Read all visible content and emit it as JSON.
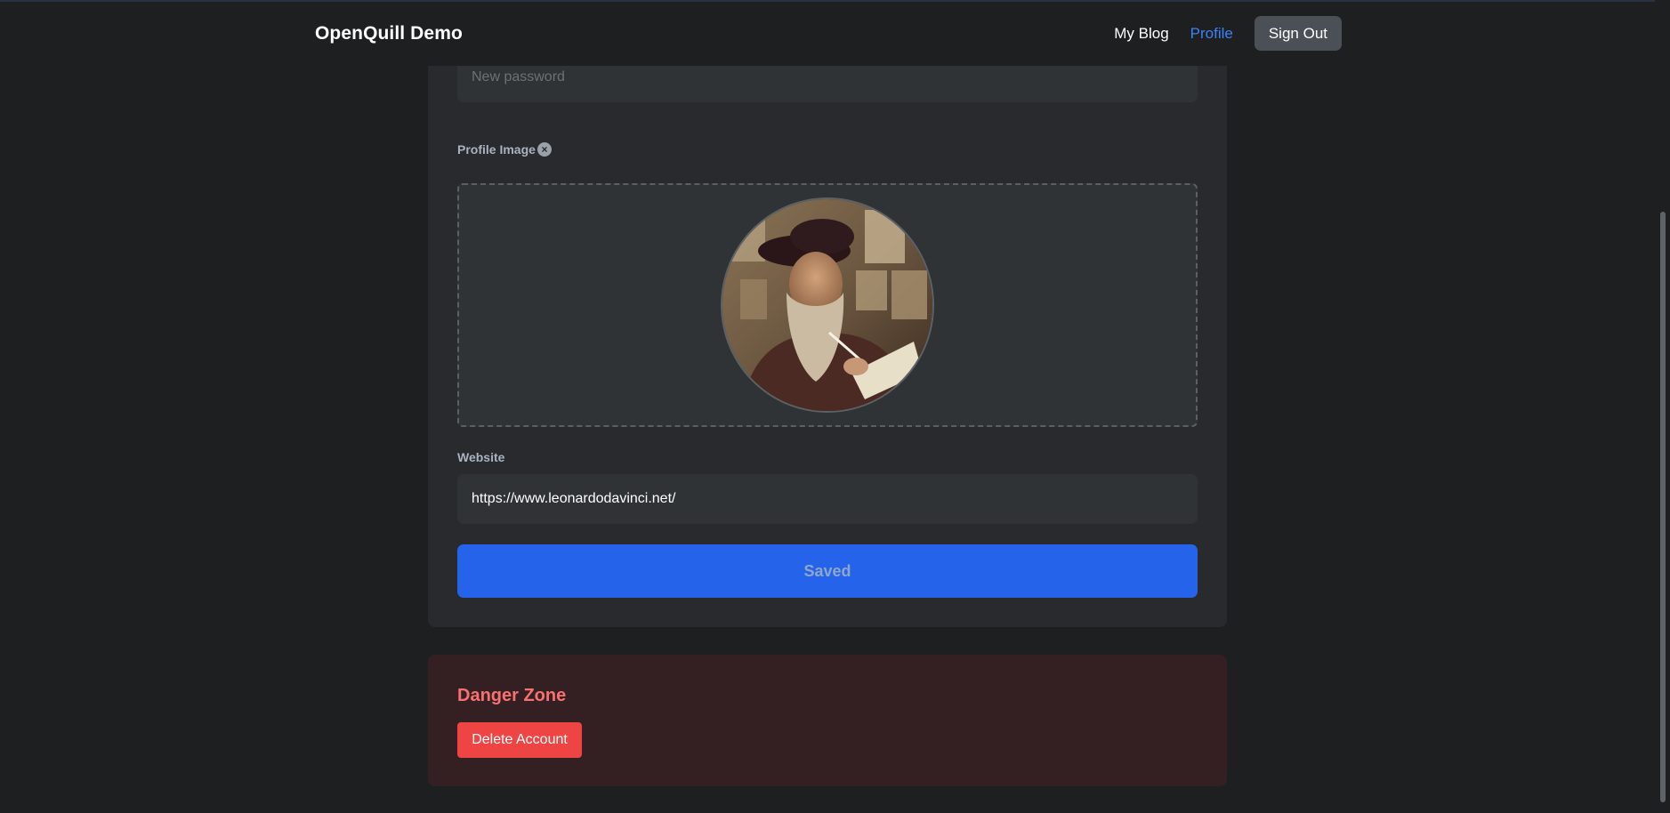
{
  "header": {
    "brand": "OpenQuill Demo",
    "nav": {
      "my_blog": "My Blog",
      "profile": "Profile",
      "sign_out": "Sign Out"
    }
  },
  "form": {
    "password": {
      "placeholder": "New password",
      "value": ""
    },
    "profile_image": {
      "label": "Profile Image",
      "clear_icon": "clear-icon"
    },
    "website": {
      "label": "Website",
      "value": "https://www.leonardodavinci.net/"
    },
    "save_label": "Saved"
  },
  "danger_zone": {
    "title": "Danger Zone",
    "delete_label": "Delete Account"
  },
  "colors": {
    "accent": "#2563eb",
    "active_link": "#3b82f6",
    "danger": "#ef4444",
    "danger_text": "#f87171"
  }
}
